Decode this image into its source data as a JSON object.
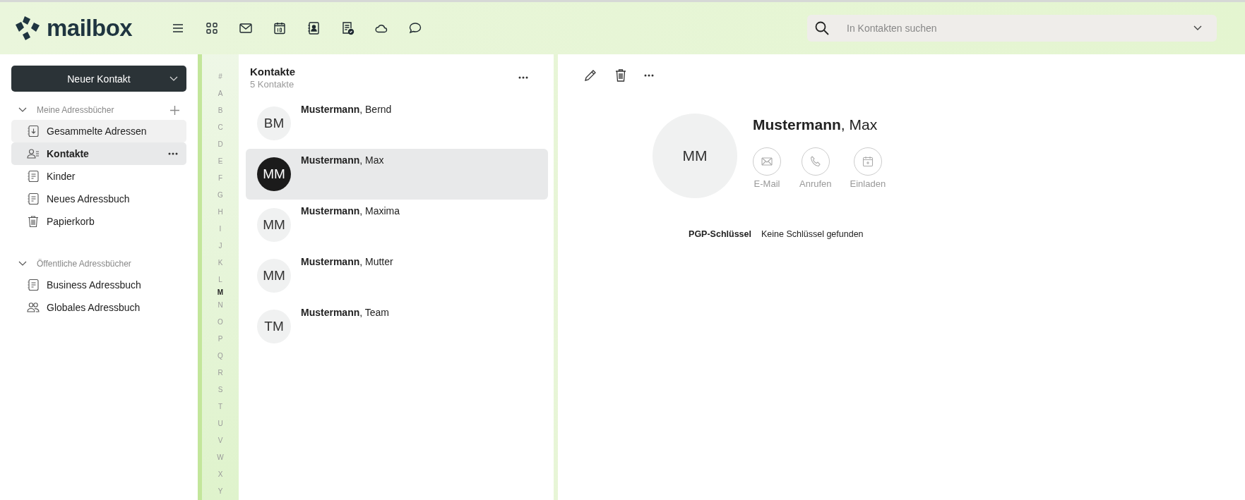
{
  "header": {
    "logo": "mailbox",
    "search": {
      "placeholder": "In Kontakten suchen"
    }
  },
  "sidebar": {
    "new_button": "Neuer Kontakt",
    "sections": [
      {
        "title": "Meine Adressbücher",
        "expanded": true,
        "items": [
          {
            "label": "Gesammelte Adressen",
            "kind": "collected",
            "selected": false,
            "hovered": true
          },
          {
            "label": "Kontakte",
            "kind": "contacts",
            "selected": true,
            "hovered": false
          },
          {
            "label": "Kinder",
            "kind": "book",
            "selected": false,
            "hovered": false
          },
          {
            "label": "Neues Adressbuch",
            "kind": "book",
            "selected": false,
            "hovered": false
          },
          {
            "label": "Papierkorb",
            "kind": "trash",
            "selected": false,
            "hovered": false
          }
        ]
      },
      {
        "title": "Öffentliche Adressbücher",
        "expanded": true,
        "items": [
          {
            "label": "Business Adressbuch",
            "kind": "book",
            "selected": false,
            "hovered": false
          },
          {
            "label": "Globales Adressbuch",
            "kind": "group",
            "selected": false,
            "hovered": false
          }
        ]
      }
    ]
  },
  "alphabet": [
    {
      "letter": "#",
      "active": false
    },
    {
      "letter": "A",
      "active": false
    },
    {
      "letter": "B",
      "active": false
    },
    {
      "letter": "C",
      "active": false
    },
    {
      "letter": "D",
      "active": false
    },
    {
      "letter": "E",
      "active": false
    },
    {
      "letter": "F",
      "active": false
    },
    {
      "letter": "G",
      "active": false
    },
    {
      "letter": "H",
      "active": false
    },
    {
      "letter": "I",
      "active": false
    },
    {
      "letter": "J",
      "active": false
    },
    {
      "letter": "K",
      "active": false
    },
    {
      "letter": "L",
      "active": false
    },
    {
      "letter": "M",
      "active": true
    },
    {
      "letter": "N",
      "active": false
    },
    {
      "letter": "O",
      "active": false
    },
    {
      "letter": "P",
      "active": false
    },
    {
      "letter": "Q",
      "active": false
    },
    {
      "letter": "R",
      "active": false
    },
    {
      "letter": "S",
      "active": false
    },
    {
      "letter": "T",
      "active": false
    },
    {
      "letter": "U",
      "active": false
    },
    {
      "letter": "V",
      "active": false
    },
    {
      "letter": "W",
      "active": false
    },
    {
      "letter": "X",
      "active": false
    },
    {
      "letter": "Y",
      "active": false
    }
  ],
  "contact_list": {
    "title": "Kontakte",
    "count": "5 Kontakte",
    "contacts": [
      {
        "initials": "BM",
        "last_name": "Mustermann",
        "first_name": ", Bernd",
        "selected": false
      },
      {
        "initials": "MM",
        "last_name": "Mustermann",
        "first_name": ", Max",
        "selected": true
      },
      {
        "initials": "MM",
        "last_name": "Mustermann",
        "first_name": ", Maxima",
        "selected": false
      },
      {
        "initials": "MM",
        "last_name": "Mustermann",
        "first_name": ", Mutter",
        "selected": false
      },
      {
        "initials": "TM",
        "last_name": "Mustermann",
        "first_name": ", Team",
        "selected": false
      }
    ]
  },
  "detail": {
    "initials": "MM",
    "name": "**Mustermann**, Max",
    "actions": [
      {
        "label": "E-Mail",
        "kind": "mail"
      },
      {
        "label": "Anrufen",
        "kind": "phone"
      },
      {
        "label": "Einladen",
        "kind": "invite"
      }
    ],
    "fields": [
      {
        "label": "PGP-Schlüssel",
        "value": "Keine Schlüssel gefunden"
      }
    ]
  }
}
